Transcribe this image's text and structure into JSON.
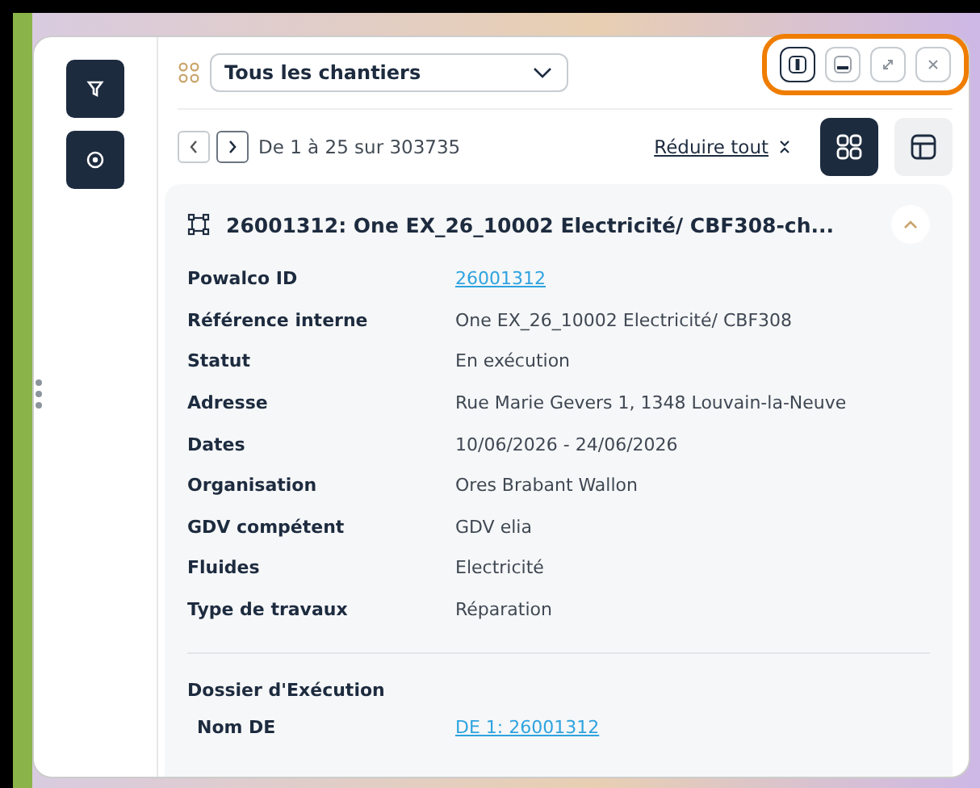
{
  "toolbar": {
    "filter_label": "Tous les chantiers",
    "window_buttons": [
      {
        "kind": "split-vertical",
        "selected": true
      },
      {
        "kind": "split-horizontal",
        "selected": false
      },
      {
        "kind": "expand",
        "selected": false
      },
      {
        "kind": "close",
        "selected": false
      }
    ],
    "highlighted": true
  },
  "pagination": {
    "range": "De 1 à 25 sur 303735",
    "collapse_all": "Réduire tout",
    "views": [
      {
        "kind": "cards",
        "selected": true
      },
      {
        "kind": "table",
        "selected": false
      }
    ]
  },
  "card": {
    "title": "26001312: One EX_26_10002 Electricité/ CBF308-ch...",
    "expanded": true,
    "fields": [
      {
        "label": "Powalco ID",
        "value": "26001312",
        "link": true
      },
      {
        "label": "Référence interne",
        "value": "One EX_26_10002 Electricité/ CBF308",
        "link": false
      },
      {
        "label": "Statut",
        "value": "En exécution",
        "link": false
      },
      {
        "label": "Adresse",
        "value": "Rue Marie Gevers 1, 1348 Louvain-la-Neuve",
        "link": false
      },
      {
        "label": "Dates",
        "value": "10/06/2026 - 24/06/2026",
        "link": false
      },
      {
        "label": "Organisation",
        "value": "Ores Brabant Wallon",
        "link": false
      },
      {
        "label": "GDV compétent",
        "value": "GDV elia",
        "link": false
      },
      {
        "label": "Fluides",
        "value": "Electricité",
        "link": false
      },
      {
        "label": "Type de travaux",
        "value": "Réparation",
        "link": false
      }
    ],
    "section_title": "Dossier d'Exécution",
    "section_fields": [
      {
        "label": "Nom DE",
        "value": "DE 1: 26001312",
        "link": true
      }
    ]
  }
}
